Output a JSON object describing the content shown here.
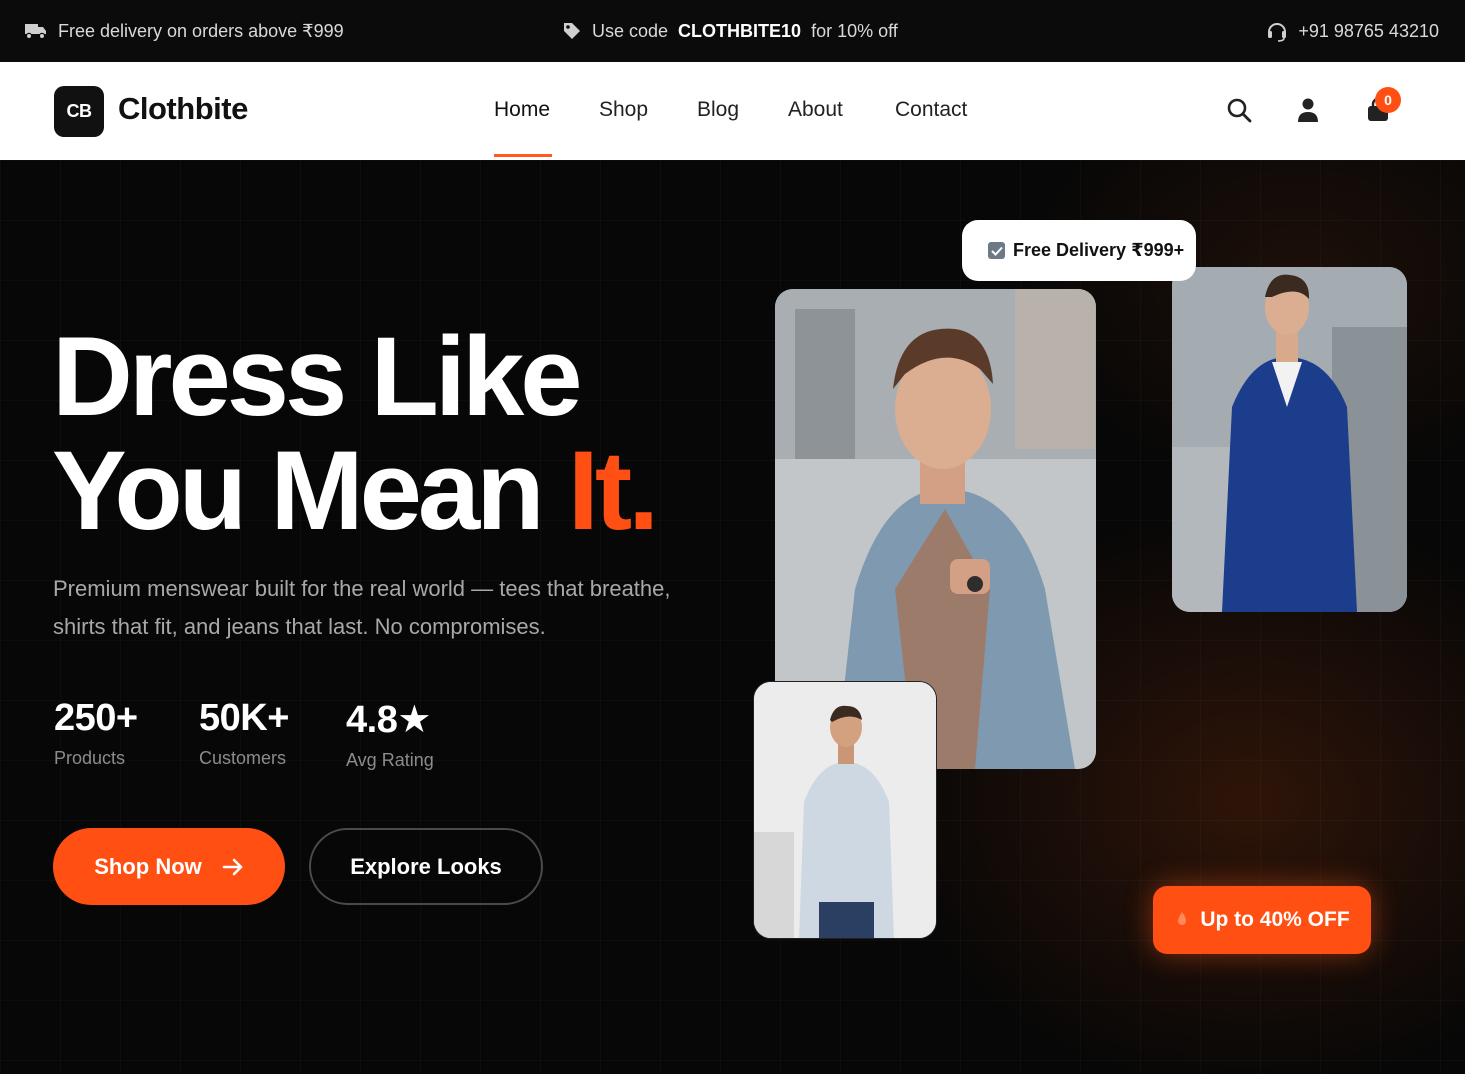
{
  "announcement": {
    "left_text": "Free delivery on orders above ₹999",
    "center_prefix": "Use code",
    "center_code": "CLOTHBITE10",
    "center_suffix": "for 10% off",
    "phone": "+91 98765 43210",
    "icons": [
      "truck-icon",
      "tag-icon",
      "headset-icon"
    ]
  },
  "brand": {
    "monogram": "CB",
    "name": "Clothbite"
  },
  "nav": {
    "links": [
      "Home",
      "Shop",
      "Blog",
      "About",
      "Contact"
    ],
    "active": "Home",
    "icons": [
      "search-icon",
      "user-icon",
      "cart-icon"
    ],
    "cart_count": "0"
  },
  "hero": {
    "headline_line1": "Dress Like",
    "headline_line2_prefix": "You Mean",
    "headline_accent": "It.",
    "subtext": "Premium menswear built for the real world — tees that breathe, shirts that fit, and jeans that last. No compromises.",
    "stats": [
      {
        "value": "250+",
        "label": "Products"
      },
      {
        "value": "50K+",
        "label": "Customers"
      },
      {
        "value": "4.8★",
        "label": "Avg Rating"
      }
    ],
    "primary_cta": "Shop Now",
    "secondary_cta": "Explore Looks",
    "badge_delivery": "Free Delivery ₹999+",
    "badge_offer": "Up to 40% OFF"
  },
  "colors": {
    "accent": "#ff4f12",
    "background": "#070707",
    "nav_background": "#ffffff"
  }
}
